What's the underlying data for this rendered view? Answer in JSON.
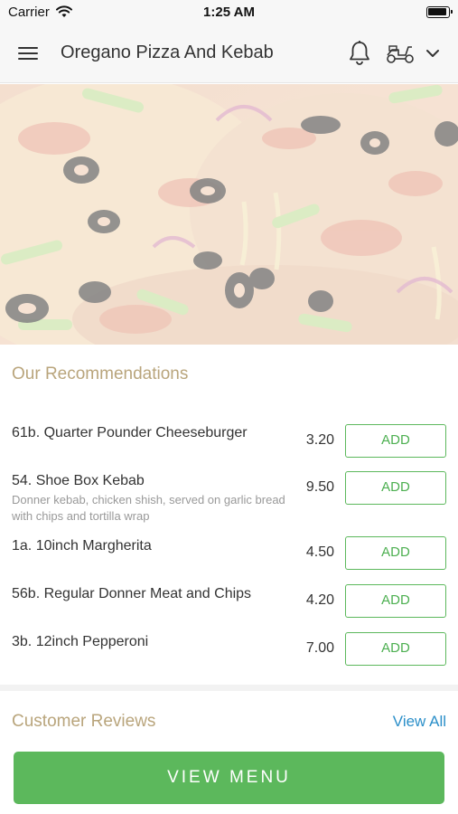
{
  "status_bar": {
    "carrier": "Carrier",
    "time": "1:25 AM"
  },
  "header": {
    "title": "Oregano Pizza And Kebab",
    "icons": [
      "menu-icon",
      "bell-icon",
      "scooter-icon",
      "chevron-down-icon"
    ]
  },
  "recommendations": {
    "title": "Our Recommendations",
    "add_label": "ADD",
    "items": [
      {
        "name": "61b. Quarter Pounder Cheeseburger",
        "description": "",
        "price": "3.20"
      },
      {
        "name": "54. Shoe Box Kebab",
        "description": "Donner kebab, chicken shish, served on garlic bread with chips and tortilla wrap",
        "price": "9.50"
      },
      {
        "name": "1a. 10inch Margherita",
        "description": "",
        "price": "4.50"
      },
      {
        "name": "56b. Regular Donner Meat and Chips",
        "description": "",
        "price": "4.20"
      },
      {
        "name": "3b. 12inch Pepperoni",
        "description": "",
        "price": "7.00"
      }
    ]
  },
  "reviews": {
    "title": "Customer Reviews",
    "view_all": "View All"
  },
  "footer": {
    "view_menu": "VIEW MENU"
  },
  "colors": {
    "accent_green": "#5cb85c",
    "section_title": "#b9a57c",
    "link_blue": "#2b8fc9"
  }
}
